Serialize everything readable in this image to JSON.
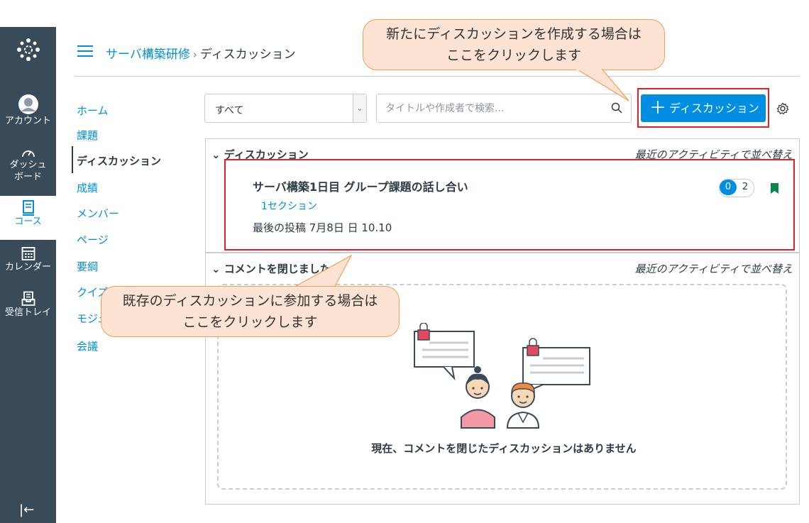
{
  "nav": {
    "account": "アカウント",
    "dashboard_line1": "ダッシュ",
    "dashboard_line2": "ボード",
    "courses": "コース",
    "calendar": "カレンダー",
    "inbox": "受信トレイ"
  },
  "breadcrumb": {
    "course": "サーバ構築研修",
    "sep": "›",
    "page": "ディスカッション"
  },
  "course_nav": [
    "ホーム",
    "課題",
    "ディスカッション",
    "成績",
    "メンバー",
    "ページ",
    "要綱",
    "クイズ",
    "モジュール",
    "会議"
  ],
  "filter": {
    "selected": "すべて",
    "search_placeholder": "タイトルや作成者で検索..."
  },
  "add_button": {
    "plus": "＋",
    "label": "ディスカッション"
  },
  "discussions_panel": {
    "heading": "ディスカッション",
    "sort": "最近のアクティビティで並べ替え",
    "item": {
      "title": "サーバ構築1日目 グループ課題の話し合い",
      "section": "1セクション",
      "last_post": "最後の投稿 7月8日 日 10.10",
      "unread": "0",
      "total": "2"
    }
  },
  "closed_panel": {
    "heading": "コメントを閉じました",
    "sort": "最近のアクティビティで並べ替え",
    "empty": "現在、コメントを閉じたディスカッションはありません"
  },
  "callouts": {
    "top_line1": "新たにディスカッションを作成する場合は",
    "top_line2": "ここをクリックします",
    "left_line1": "既存のディスカッションに参加する場合は",
    "left_line2": "ここをクリックします"
  },
  "colors": {
    "brand": "#008ee2",
    "nav_bg": "#394b58",
    "highlight": "#e0202b",
    "callout": "#fde3d3",
    "bookmark": "#0b874b"
  }
}
